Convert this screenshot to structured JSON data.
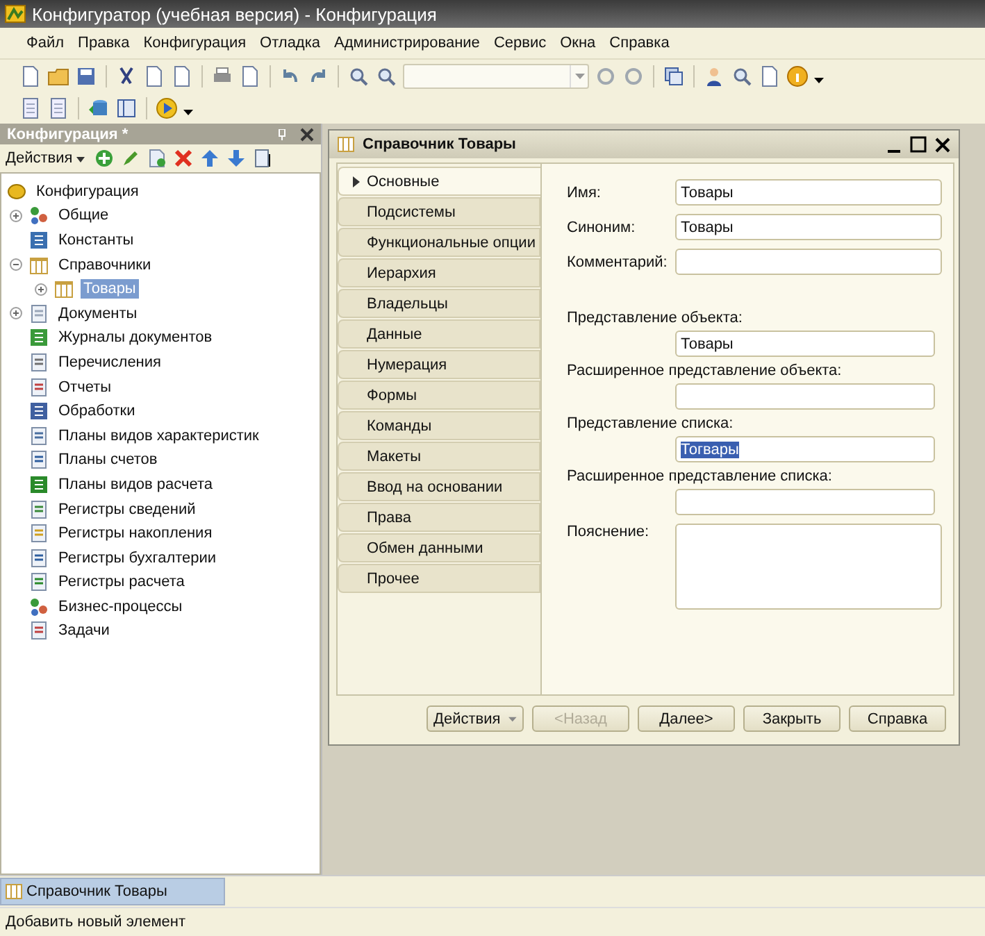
{
  "window": {
    "title": "Конфигуратор (учебная версия) - Конфигурация"
  },
  "menu": [
    "Файл",
    "Правка",
    "Конфигурация",
    "Отладка",
    "Администрирование",
    "Сервис",
    "Окна",
    "Справка"
  ],
  "panel": {
    "title": "Конфигурация *",
    "actions_label": "Действия",
    "tree": [
      {
        "label": "Конфигурация",
        "selected": false,
        "children": [
          {
            "label": "Общие",
            "expanded": false,
            "selected": false
          },
          {
            "label": "Константы",
            "selected": false
          },
          {
            "label": "Справочники",
            "expanded": true,
            "selected": false,
            "children": [
              {
                "label": "Товары",
                "expanded": false,
                "selected": true
              }
            ]
          },
          {
            "label": "Документы",
            "expanded": false,
            "selected": false
          },
          {
            "label": "Журналы документов",
            "selected": false
          },
          {
            "label": "Перечисления",
            "selected": false
          },
          {
            "label": "Отчеты",
            "selected": false
          },
          {
            "label": "Обработки",
            "selected": false
          },
          {
            "label": "Планы видов характеристик",
            "selected": false
          },
          {
            "label": "Планы счетов",
            "selected": false
          },
          {
            "label": "Планы видов расчета",
            "selected": false
          },
          {
            "label": "Регистры сведений",
            "selected": false
          },
          {
            "label": "Регистры накопления",
            "selected": false
          },
          {
            "label": "Регистры бухгалтерии",
            "selected": false
          },
          {
            "label": "Регистры расчета",
            "selected": false
          },
          {
            "label": "Бизнес-процессы",
            "selected": false
          },
          {
            "label": "Задачи",
            "selected": false
          }
        ]
      }
    ]
  },
  "child_window": {
    "title": "Справочник Товары",
    "tabs": [
      {
        "label": "Основные",
        "selected": true
      },
      {
        "label": "Подсистемы",
        "selected": false
      },
      {
        "label": "Функциональные опции",
        "selected": false
      },
      {
        "label": "Иерархия",
        "selected": false
      },
      {
        "label": "Владельцы",
        "selected": false
      },
      {
        "label": "Данные",
        "selected": false
      },
      {
        "label": "Нумерация",
        "selected": false
      },
      {
        "label": "Формы",
        "selected": false
      },
      {
        "label": "Команды",
        "selected": false
      },
      {
        "label": "Макеты",
        "selected": false
      },
      {
        "label": "Ввод на основании",
        "selected": false
      },
      {
        "label": "Права",
        "selected": false
      },
      {
        "label": "Обмен данными",
        "selected": false
      },
      {
        "label": "Прочее",
        "selected": false
      }
    ],
    "fields": [
      {
        "kind": "inline",
        "label": "Имя:",
        "value": "Товары",
        "highlighted": false
      },
      {
        "kind": "inline",
        "label": "Синоним:",
        "value": "Товары",
        "highlighted": false
      },
      {
        "kind": "inline",
        "label": "Комментарий:"
      },
      {
        "kind": "spacer"
      },
      {
        "kind": "above",
        "label": "Представление объекта:",
        "value": "Товары",
        "highlighted": false
      },
      {
        "kind": "above",
        "label": "Расширенное представление объекта:"
      },
      {
        "kind": "above",
        "label": "Представление списка:",
        "value": "Тогвары",
        "highlighted": true
      },
      {
        "kind": "above",
        "label": "Расширенное представление списка:"
      },
      {
        "kind": "multiline",
        "label": "Пояснение:"
      }
    ],
    "buttons": [
      {
        "label": "Действия",
        "kind": "menu",
        "disabled": false
      },
      {
        "label": "<Назад",
        "kind": "plain",
        "disabled": true
      },
      {
        "label": "Далее>",
        "kind": "plain",
        "disabled": false
      },
      {
        "label": "Закрыть",
        "kind": "plain",
        "disabled": false
      },
      {
        "label": "Справка",
        "kind": "plain",
        "disabled": false
      }
    ]
  },
  "taskbar": [
    {
      "label": "Справочник Товары",
      "selected": true
    }
  ],
  "status_bar": "Добавить новый элемент"
}
